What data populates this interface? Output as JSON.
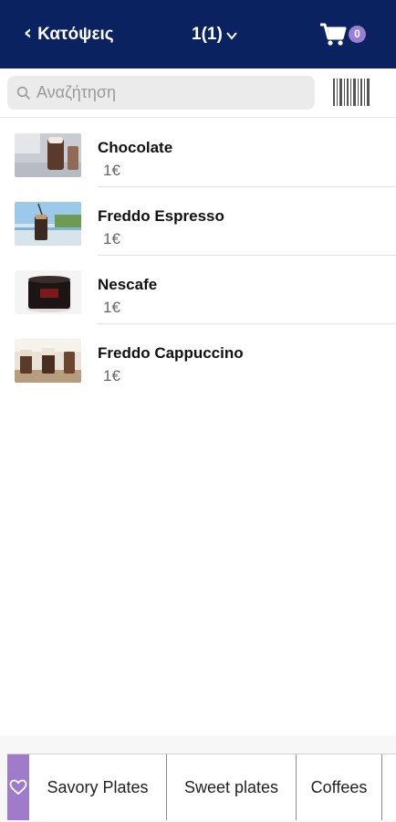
{
  "header": {
    "back_label": "Κατόψεις",
    "title": "1(1)",
    "cart_count": "0",
    "background_color": "#0b2260",
    "icons": {
      "back": "chevron-left-icon",
      "dropdown": "chevron-down-icon",
      "cart": "cart-icon"
    }
  },
  "search": {
    "placeholder": "Αναζήτηση",
    "value": "",
    "icons": {
      "search": "search-icon",
      "barcode": "barcode-icon"
    }
  },
  "products": [
    {
      "name": "Chocolate",
      "price": "1€"
    },
    {
      "name": "Freddo Espresso",
      "price": "1€"
    },
    {
      "name": "Nescafe",
      "price": "1€"
    },
    {
      "name": "Freddo Cappuccino",
      "price": "1€"
    }
  ],
  "category_tabs": {
    "favorite_icon": "heart-icon",
    "accent_color": "#a07bc9",
    "items": [
      {
        "label": "Savory Plates"
      },
      {
        "label": "Sweet plates"
      },
      {
        "label": "Coffees"
      },
      {
        "label": ""
      }
    ]
  }
}
